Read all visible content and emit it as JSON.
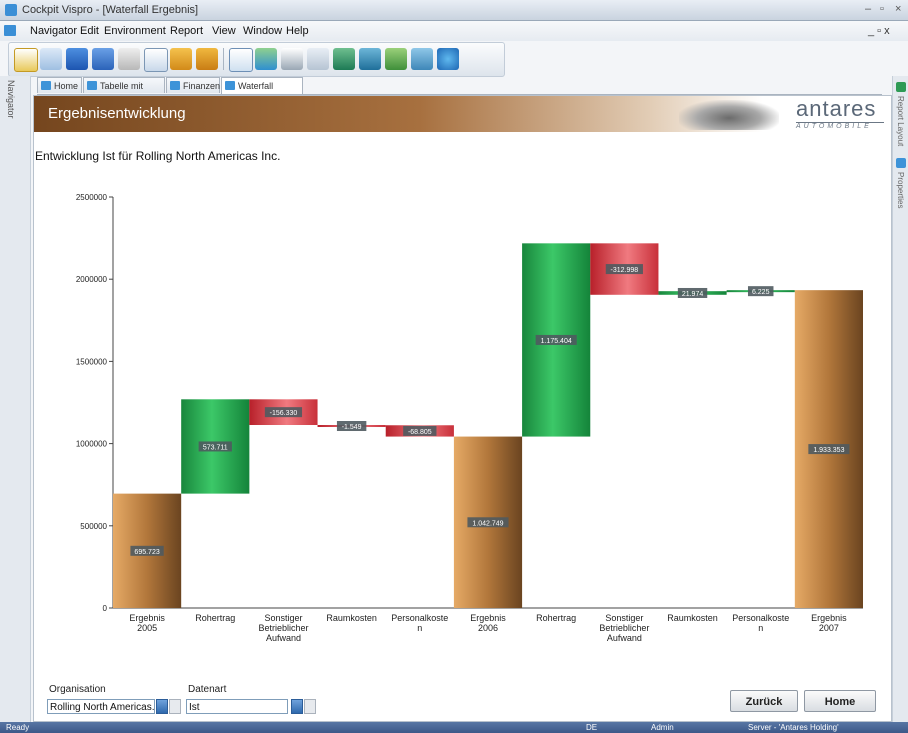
{
  "window": {
    "title": "Cockpit Vispro - [Waterfall Ergebnis]"
  },
  "menu": {
    "items": [
      "Navigator",
      "Edit",
      "Environment",
      "Report",
      "View",
      "Window",
      "Help"
    ],
    "mdi_controls": "_ ▫ x"
  },
  "side": {
    "left_label": "Navigator",
    "right_label_1": "Report Layout",
    "right_label_2": "Properties"
  },
  "tabs": [
    "Home",
    "Tabelle mit Ampeln",
    "Finanzen",
    "Waterfall Ergebnis"
  ],
  "banner": {
    "title": "Ergebnisentwicklung",
    "brand": "antares",
    "brand_sub": "AUTOMOBILE"
  },
  "report": {
    "subtitle": "Entwicklung Ist für Rolling North Americas Inc."
  },
  "chart_data": {
    "type": "bar",
    "subtype": "waterfall",
    "ylim": [
      0,
      2500000
    ],
    "yticks": [
      "0",
      "500000",
      "1000000",
      "1500000",
      "2000000",
      "2500000"
    ],
    "categories": [
      "Ergebnis 2005",
      "Rohertrag",
      "Sonstiger Betrieblicher Aufwand",
      "Raumkosten",
      "Personalkosten",
      "Ergebnis 2006",
      "Rohertrag",
      "Sonstiger Betrieblicher Aufwand",
      "Raumkosten",
      "Personalkosten",
      "Ergebnis 2007"
    ],
    "category_labels": [
      [
        "Ergebnis",
        "2005"
      ],
      [
        "Rohertrag"
      ],
      [
        "Sonstiger",
        "Betrieblicher",
        "Aufwand"
      ],
      [
        "Raumkosten"
      ],
      [
        "Personalkoste",
        "n"
      ],
      [
        "Ergebnis",
        "2006"
      ],
      [
        "Rohertrag"
      ],
      [
        "Sonstiger",
        "Betrieblicher",
        "Aufwand"
      ],
      [
        "Raumkosten"
      ],
      [
        "Personalkoste",
        "n"
      ],
      [
        "Ergebnis",
        "2007"
      ]
    ],
    "values": [
      695723,
      573711,
      -156330,
      -1549,
      -68805,
      1042749,
      1175404,
      -312998,
      21974,
      6225,
      1933353
    ],
    "bar_kinds": [
      "total",
      "delta",
      "delta",
      "delta",
      "delta",
      "total",
      "delta",
      "delta",
      "delta",
      "delta",
      "total"
    ],
    "value_labels": [
      "695.723",
      "573.711",
      "-156.330",
      "-1.549",
      "-68.805",
      "1.042.749",
      "1.175.404",
      "-312.998",
      "21.974",
      "6.225",
      "1.933.353"
    ],
    "colors": {
      "total": "#b2773b",
      "positive": "#22a34c",
      "negative": "#d8343c"
    }
  },
  "filters": {
    "organisation_label": "Organisation",
    "organisation_value": "Rolling North Americas...",
    "datenart_label": "Datenart",
    "datenart_value": "Ist"
  },
  "buttons": {
    "back": "Zurück",
    "home": "Home"
  },
  "status": {
    "ready": "Ready",
    "lang": "DE",
    "user": "Admin",
    "server": "Server - 'Antares Holding'"
  }
}
